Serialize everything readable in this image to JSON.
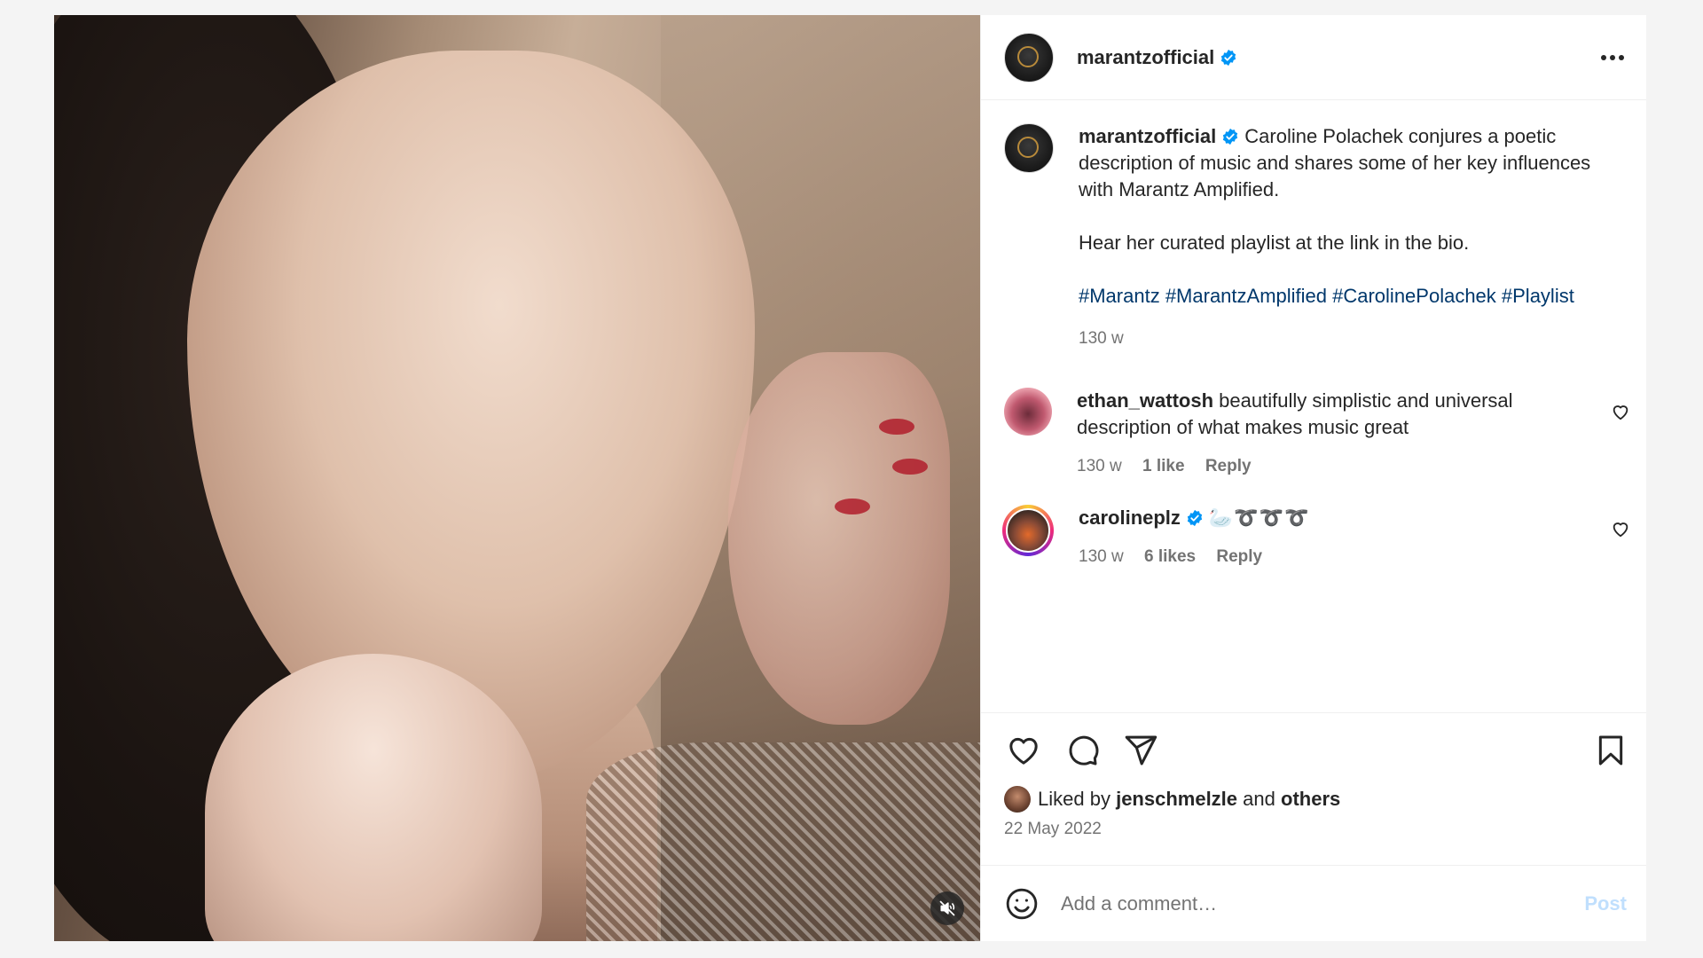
{
  "post": {
    "author": "marantzofficial",
    "header_more_icon": "more-horizontal-icon",
    "media": {
      "mute_icon": "speaker-muted-icon"
    }
  },
  "caption": {
    "username": "marantzofficial",
    "line1": "Caroline Polachek conjures a poetic description of music and shares some of her key influences with Marantz Amplified.",
    "line2": "Hear her curated playlist at the link in the bio.",
    "hashtags": "#Marantz #MarantzAmplified #CarolinePolachek #Playlist",
    "time": "130 w"
  },
  "comments": [
    {
      "username": "ethan_wattosh",
      "text": "beautifully simplistic and universal description of what makes music great",
      "time": "130 w",
      "likes": "1 like",
      "reply": "Reply"
    },
    {
      "username": "carolineplz",
      "text": "🦢➰➰➰",
      "time": "130 w",
      "likes": "6 likes",
      "reply": "Reply"
    }
  ],
  "actions": {
    "liked_prefix": "Liked by",
    "liked_user": "jenschmelzle",
    "liked_and": "and",
    "liked_others": "others",
    "date": "22 May 2022"
  },
  "add_comment": {
    "placeholder": "Add a comment…",
    "post_label": "Post"
  },
  "colors": {
    "verified": "#0095f6",
    "link": "#00376b",
    "muted_text": "#737373",
    "post_disabled": "#c0dffd"
  }
}
